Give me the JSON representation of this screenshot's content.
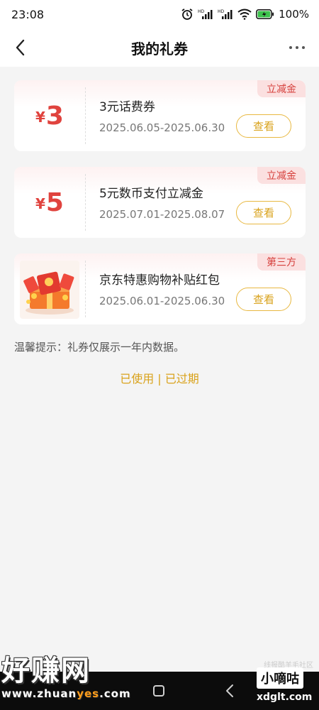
{
  "status_bar": {
    "time": "23:08",
    "battery": "100%",
    "icons": [
      "alarm-icon",
      "hd-signal-icon",
      "hd-signal-icon",
      "wifi-icon",
      "battery-icon"
    ]
  },
  "header": {
    "title": "我的礼券",
    "back_icon": "chevron-left-icon",
    "more_icon": "more-dots-icon"
  },
  "coupons": [
    {
      "currency": "¥",
      "amount": "3",
      "name": "3元话费券",
      "date": "2025.06.05-2025.06.30",
      "tag": "立减金",
      "button": "查看"
    },
    {
      "currency": "¥",
      "amount": "5",
      "name": "5元数币支付立减金",
      "date": "2025.07.01-2025.08.07",
      "tag": "立减金",
      "button": "查看"
    },
    {
      "image": "red-envelope-gift-icon",
      "name": "京东特惠购物补贴红包",
      "date": "2025.06.01-2025.06.30",
      "tag": "第三方",
      "button": "查看"
    }
  ],
  "tip": "温馨提示：礼券仅展示一年内数据。",
  "history": {
    "used": "已使用",
    "separator": "|",
    "expired": "已过期"
  },
  "watermark": {
    "left_big": "好赚网",
    "left_small_a": "www.zhuan",
    "left_small_b": "yes",
    "left_small_c": ".com",
    "right_tag": "小嘀咕",
    "right_url": "xdglt.com",
    "faint": "线报酷羊毛社区"
  },
  "colors": {
    "accent_red": "#e0433e",
    "accent_gold": "#d9a21b",
    "tag_bg": "#fbe0e0",
    "page_bg": "#f4f4f4"
  }
}
